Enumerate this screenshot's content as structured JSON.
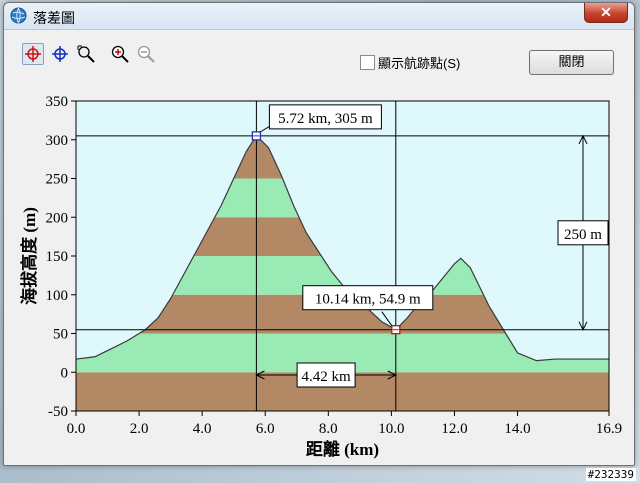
{
  "window": {
    "title": "落差圖",
    "close_glyph": "✕"
  },
  "toolbar": {
    "tools": [
      "crosshair-red-tool",
      "crosshair-blue-tool",
      "zoom-select-tool",
      "zoom-in-tool",
      "zoom-out-tool"
    ],
    "show_waypoints_label": "顯示航跡點(S)",
    "show_waypoints_checked": false,
    "close_button_label": "關閉"
  },
  "colors": {
    "plot_bg": "#dff8fb",
    "brown": "#b38965",
    "green": "#99eab4",
    "line": "#3a3a3a"
  },
  "chart_data": {
    "type": "area",
    "xlabel": "距離 (km)",
    "ylabel": "海拔高度 (m)",
    "xlim": [
      0.0,
      16.9
    ],
    "ylim": [
      -50,
      350
    ],
    "xticks": [
      "0.0",
      "2.0",
      "4.0",
      "6.0",
      "8.0",
      "10.0",
      "12.0",
      "14.0",
      "16.9"
    ],
    "yticks": [
      "-50",
      "0",
      "50",
      "100",
      "150",
      "200",
      "250",
      "300",
      "350"
    ],
    "series": [
      {
        "x": [
          0.0,
          0.6,
          1.0,
          1.6,
          2.2,
          2.6,
          3.0,
          3.4,
          3.8,
          4.2,
          4.6,
          5.0,
          5.4,
          5.72,
          6.1,
          6.5,
          6.9,
          7.3,
          7.7,
          8.1,
          8.5,
          8.9,
          9.3,
          9.7,
          10.14,
          10.5,
          10.9,
          11.3,
          11.7,
          12.0,
          12.2,
          12.5,
          12.8,
          13.1,
          13.4,
          13.7,
          14.0,
          14.6,
          15.2,
          16.0,
          16.9
        ],
        "y": [
          17,
          20,
          28,
          40,
          55,
          70,
          95,
          125,
          155,
          185,
          215,
          250,
          285,
          305,
          290,
          255,
          215,
          180,
          155,
          130,
          110,
          95,
          80,
          65,
          54.9,
          70,
          90,
          105,
          125,
          140,
          147,
          135,
          110,
          85,
          65,
          45,
          25,
          15,
          17,
          17,
          17
        ]
      }
    ],
    "band_step_m": 50,
    "annotations": {
      "peak": {
        "x": 5.72,
        "y": 305,
        "label": "5.72 km, 305 m"
      },
      "cursor": {
        "x": 10.14,
        "y": 54.9,
        "label": "10.14 km, 54.9 m"
      },
      "height_diff_label": "250 m",
      "distance_diff_label": "4.42 km"
    }
  },
  "watermark": "#232339"
}
